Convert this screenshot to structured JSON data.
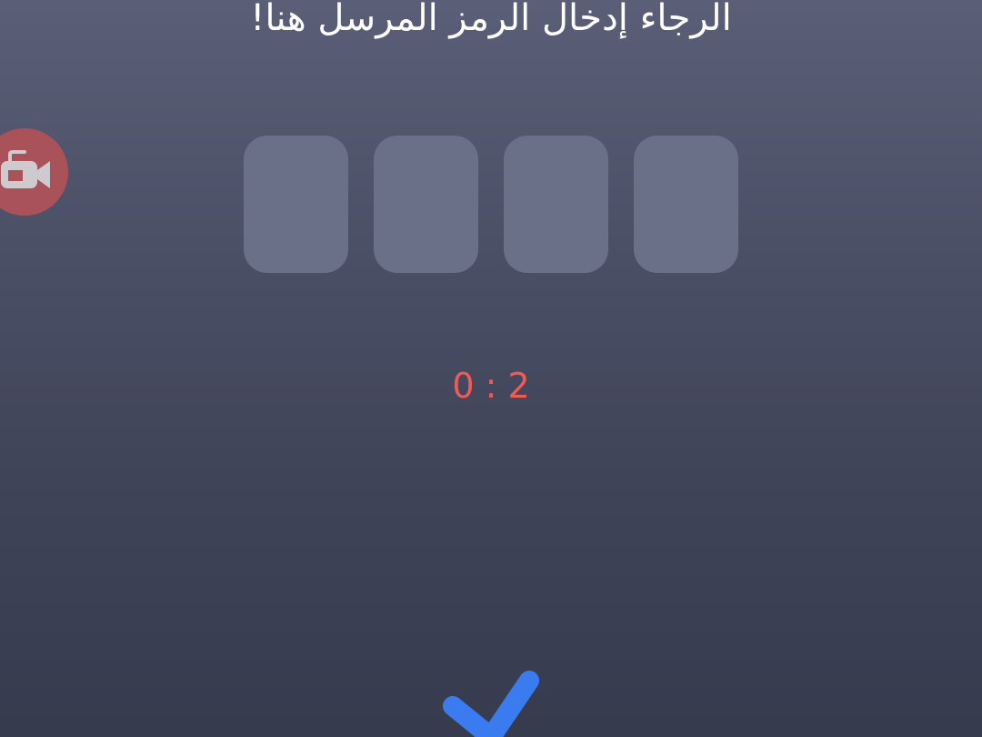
{
  "header": {
    "title": "الرجاء إدخال الرمز المرسل هنا!"
  },
  "code_input": {
    "digits": [
      "",
      "",
      "",
      ""
    ]
  },
  "timer": {
    "text": "0 : 2"
  },
  "icons": {
    "record": "video-camera-icon",
    "confirm": "checkmark-icon"
  },
  "colors": {
    "background_top": "#5a5f77",
    "background_bottom": "#363b4e",
    "code_box": "#6b7089",
    "timer": "#f15a55",
    "record_button": "#b25258",
    "confirm": "#3b7bf0"
  }
}
